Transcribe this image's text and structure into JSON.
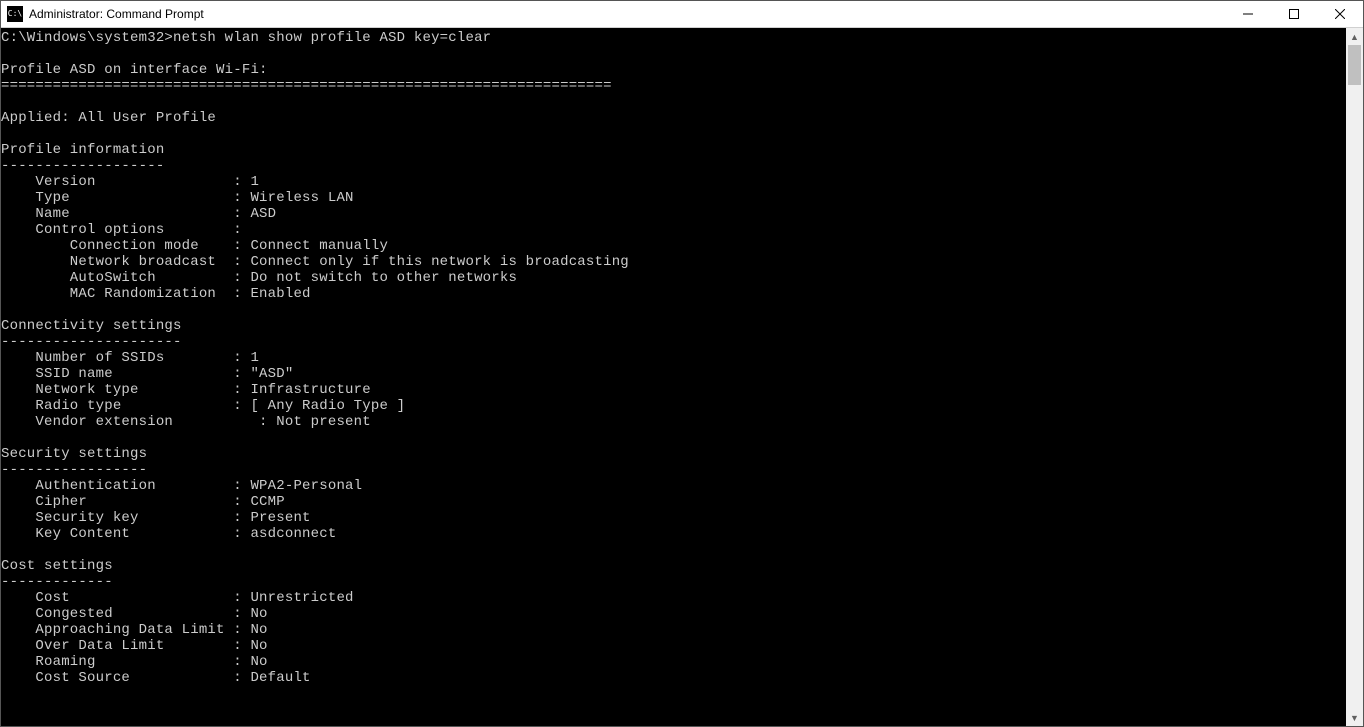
{
  "window": {
    "icon_text": "C:\\",
    "title": "Administrator: Command Prompt"
  },
  "prompt": {
    "path": "C:\\Windows\\system32>",
    "command": "netsh wlan show profile ASD key=clear"
  },
  "header": {
    "profile_line": "Profile ASD on interface Wi-Fi:",
    "separator": "=======================================================================",
    "applied": "Applied: All User Profile"
  },
  "sections": {
    "profile_info": {
      "title": "Profile information",
      "underline": "-------------------",
      "rows": [
        {
          "label": "Version",
          "value": "1"
        },
        {
          "label": "Type",
          "value": "Wireless LAN"
        },
        {
          "label": "Name",
          "value": "ASD"
        },
        {
          "label": "Control options",
          "value": ""
        }
      ],
      "sub_rows": [
        {
          "label": "Connection mode",
          "value": "Connect manually"
        },
        {
          "label": "Network broadcast",
          "value": "Connect only if this network is broadcasting"
        },
        {
          "label": "AutoSwitch",
          "value": "Do not switch to other networks"
        },
        {
          "label": "MAC Randomization",
          "value": "Enabled"
        }
      ]
    },
    "connectivity": {
      "title": "Connectivity settings",
      "underline": "---------------------",
      "rows": [
        {
          "label": "Number of SSIDs",
          "value": "1"
        },
        {
          "label": "SSID name",
          "value": "\"ASD\""
        },
        {
          "label": "Network type",
          "value": "Infrastructure"
        },
        {
          "label": "Radio type",
          "value": "[ Any Radio Type ]"
        }
      ],
      "vendor_row": {
        "label": "Vendor extension",
        "value": "Not present"
      }
    },
    "security": {
      "title": "Security settings",
      "underline": "-----------------",
      "rows": [
        {
          "label": "Authentication",
          "value": "WPA2-Personal"
        },
        {
          "label": "Cipher",
          "value": "CCMP"
        },
        {
          "label": "Security key",
          "value": "Present"
        },
        {
          "label": "Key Content",
          "value": "asdconnect"
        }
      ]
    },
    "cost": {
      "title": "Cost settings",
      "underline": "-------------",
      "rows": [
        {
          "label": "Cost",
          "value": "Unrestricted"
        },
        {
          "label": "Congested",
          "value": "No"
        },
        {
          "label": "Approaching Data Limit",
          "value": "No"
        },
        {
          "label": "Over Data Limit",
          "value": "No"
        },
        {
          "label": "Roaming",
          "value": "No"
        },
        {
          "label": "Cost Source",
          "value": "Default"
        }
      ]
    }
  }
}
